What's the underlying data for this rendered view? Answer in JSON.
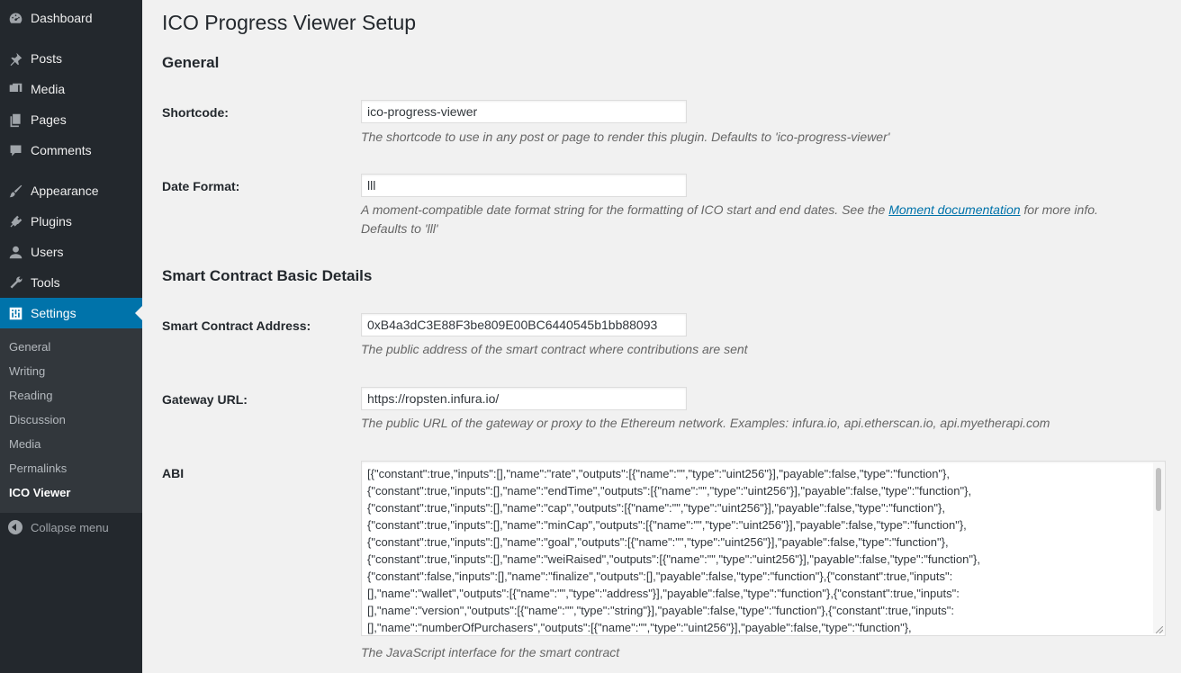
{
  "sidebar": {
    "items": [
      {
        "label": "Dashboard",
        "icon": "dashboard-icon"
      },
      {
        "label": "Posts",
        "icon": "pin-icon"
      },
      {
        "label": "Media",
        "icon": "media-icon"
      },
      {
        "label": "Pages",
        "icon": "pages-icon"
      },
      {
        "label": "Comments",
        "icon": "comment-icon"
      },
      {
        "label": "Appearance",
        "icon": "brush-icon"
      },
      {
        "label": "Plugins",
        "icon": "plugin-icon"
      },
      {
        "label": "Users",
        "icon": "user-icon"
      },
      {
        "label": "Tools",
        "icon": "wrench-icon"
      },
      {
        "label": "Settings",
        "icon": "settings-icon"
      }
    ],
    "submenu": [
      "General",
      "Writing",
      "Reading",
      "Discussion",
      "Media",
      "Permalinks",
      "ICO Viewer"
    ],
    "collapse_label": "Collapse menu"
  },
  "page": {
    "title": "ICO Progress Viewer Setup",
    "section_general": "General",
    "section_contract": "Smart Contract Basic Details"
  },
  "fields": {
    "shortcode": {
      "label": "Shortcode:",
      "value": "ico-progress-viewer",
      "description": "The shortcode to use in any post or page to render this plugin. Defaults to 'ico-progress-viewer'"
    },
    "date_format": {
      "label": "Date Format:",
      "value": "lll",
      "description_before": "A moment-compatible date format string for the formatting of ICO start and end dates. See the ",
      "link_text": "Moment documentation",
      "description_after": " for more info.",
      "description_line2": "Defaults to 'lll'"
    },
    "contract_address": {
      "label": "Smart Contract Address:",
      "value": "0xB4a3dC3E88F3be809E00BC6440545b1bb88093",
      "description": "The public address of the smart contract where contributions are sent"
    },
    "gateway_url": {
      "label": "Gateway URL:",
      "value": "https://ropsten.infura.io/",
      "description": "The public URL of the gateway or proxy to the Ethereum network. Examples: infura.io, api.etherscan.io, api.myetherapi.com"
    },
    "abi": {
      "label": "ABI",
      "value": "[{\"constant\":true,\"inputs\":[],\"name\":\"rate\",\"outputs\":[{\"name\":\"\",\"type\":\"uint256\"}],\"payable\":false,\"type\":\"function\"},\n{\"constant\":true,\"inputs\":[],\"name\":\"endTime\",\"outputs\":[{\"name\":\"\",\"type\":\"uint256\"}],\"payable\":false,\"type\":\"function\"},\n{\"constant\":true,\"inputs\":[],\"name\":\"cap\",\"outputs\":[{\"name\":\"\",\"type\":\"uint256\"}],\"payable\":false,\"type\":\"function\"},\n{\"constant\":true,\"inputs\":[],\"name\":\"minCap\",\"outputs\":[{\"name\":\"\",\"type\":\"uint256\"}],\"payable\":false,\"type\":\"function\"},\n{\"constant\":true,\"inputs\":[],\"name\":\"goal\",\"outputs\":[{\"name\":\"\",\"type\":\"uint256\"}],\"payable\":false,\"type\":\"function\"},\n{\"constant\":true,\"inputs\":[],\"name\":\"weiRaised\",\"outputs\":[{\"name\":\"\",\"type\":\"uint256\"}],\"payable\":false,\"type\":\"function\"},\n{\"constant\":false,\"inputs\":[],\"name\":\"finalize\",\"outputs\":[],\"payable\":false,\"type\":\"function\"},{\"constant\":true,\"inputs\":\n[],\"name\":\"wallet\",\"outputs\":[{\"name\":\"\",\"type\":\"address\"}],\"payable\":false,\"type\":\"function\"},{\"constant\":true,\"inputs\":\n[],\"name\":\"version\",\"outputs\":[{\"name\":\"\",\"type\":\"string\"}],\"payable\":false,\"type\":\"function\"},{\"constant\":true,\"inputs\":\n[],\"name\":\"numberOfPurchasers\",\"outputs\":[{\"name\":\"\",\"type\":\"uint256\"}],\"payable\":false,\"type\":\"function\"},",
      "description": "The JavaScript interface for the smart contract"
    }
  },
  "colors": {
    "sidebar_bg": "#23282d",
    "submenu_bg": "#32373c",
    "active_accent": "#0073aa",
    "page_bg": "#f1f1f1"
  }
}
